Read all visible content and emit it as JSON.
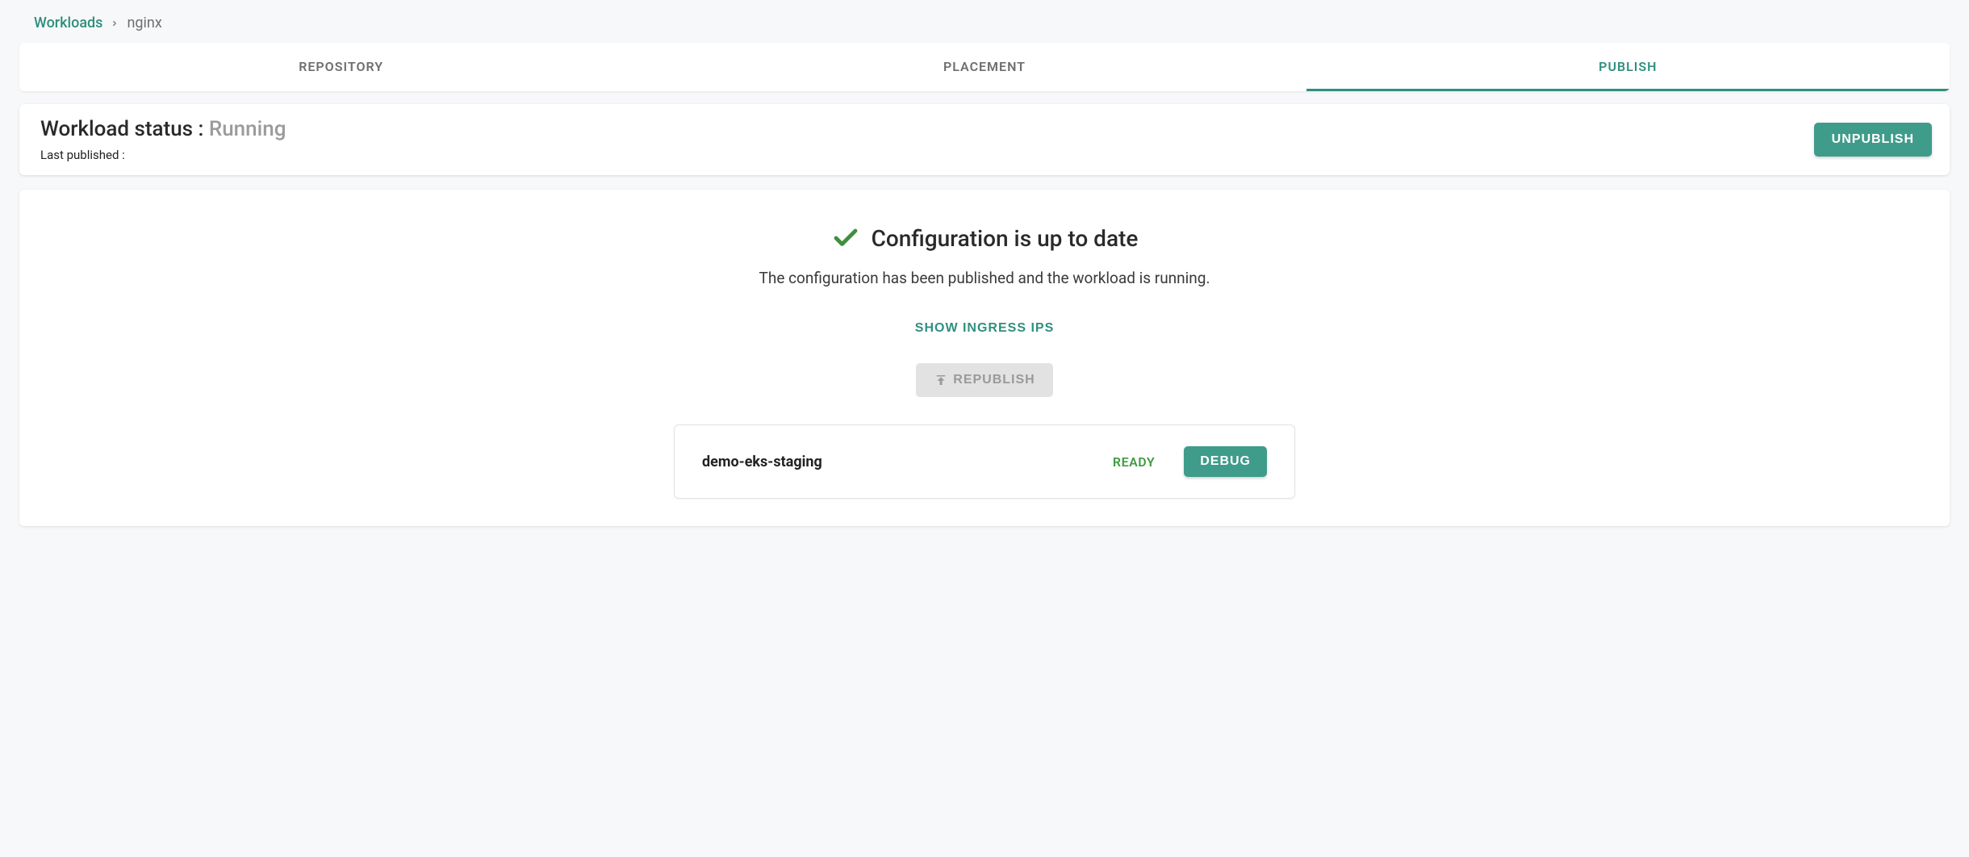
{
  "breadcrumb": {
    "root": "Workloads",
    "current": "nginx"
  },
  "tabs": {
    "repository": "Repository",
    "placement": "Placement",
    "publish": "Publish"
  },
  "status": {
    "label": "Workload status :",
    "value": "Running",
    "last_published_label": "Last published :",
    "unpublish_label": "Unpublish"
  },
  "config": {
    "title": "Configuration is up to date",
    "description": "The configuration has been published and the workload is running.",
    "show_ips_label": "Show Ingress IPs",
    "republish_label": "Republish"
  },
  "cluster": {
    "name": "demo-eks-staging",
    "status": "READY",
    "debug_label": "Debug"
  },
  "colors": {
    "teal": "#3f9c8b",
    "green_check": "#3f8f3f"
  }
}
